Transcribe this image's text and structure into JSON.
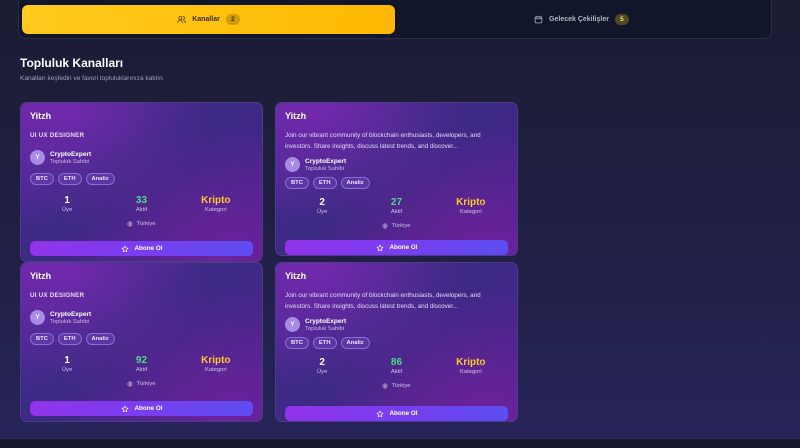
{
  "tabs": [
    {
      "label": "Kanallar",
      "count": "2",
      "icon": "users-icon",
      "active": true
    },
    {
      "label": "Gelecek Çekilişler",
      "count": "5",
      "icon": "calendar-icon",
      "active": false
    }
  ],
  "section": {
    "title": "Topluluk Kanalları",
    "subtitle": "Kanalları keşfedin ve favori topluluklarınıza katılın"
  },
  "cards": [
    {
      "title": "Yitzh",
      "description": "UI UX DESIGNER",
      "owner_initial": "Y",
      "owner_name": "CryptoExpert",
      "owner_role": "Topluluk Sahibi",
      "tags": [
        "BTC",
        "ETH",
        "Analiz"
      ],
      "stats": [
        {
          "value": "1",
          "label": "Üye"
        },
        {
          "value": "33",
          "label": "Aktif"
        },
        {
          "value": "Kripto",
          "label": "Kategori"
        }
      ],
      "country": "Türkiye",
      "button_label": "Abone Ol"
    },
    {
      "title": "Yitzh",
      "description": "Join our vibrant community of blockchain enthusiasts, developers, and investors. Share insights, discuss latest trends, and discover...",
      "owner_initial": "Y",
      "owner_name": "CryptoExpert",
      "owner_role": "Topluluk Sahibi",
      "tags": [
        "BTC",
        "ETH",
        "Analiz"
      ],
      "stats": [
        {
          "value": "2",
          "label": "Üye"
        },
        {
          "value": "27",
          "label": "Aktif"
        },
        {
          "value": "Kripto",
          "label": "Kategori"
        }
      ],
      "country": "Türkiye",
      "button_label": "Abone Ol"
    },
    {
      "title": "Yitzh",
      "description": "UI UX DESIGNER",
      "owner_initial": "Y",
      "owner_name": "CryptoExpert",
      "owner_role": "Topluluk Sahibi",
      "tags": [
        "BTC",
        "ETH",
        "Analiz"
      ],
      "stats": [
        {
          "value": "1",
          "label": "Üye"
        },
        {
          "value": "92",
          "label": "Aktif"
        },
        {
          "value": "Kripto",
          "label": "Kategori"
        }
      ],
      "country": "Türkiye",
      "button_label": "Abone Ol"
    },
    {
      "title": "Yitzh",
      "description": "Join our vibrant community of blockchain enthusiasts, developers, and investors. Share insights, discuss latest trends, and discover...",
      "owner_initial": "Y",
      "owner_name": "CryptoExpert",
      "owner_role": "Topluluk Sahibi",
      "tags": [
        "BTC",
        "ETH",
        "Analiz"
      ],
      "stats": [
        {
          "value": "2",
          "label": "Üye"
        },
        {
          "value": "86",
          "label": "Aktif"
        },
        {
          "value": "Kripto",
          "label": "Kategori"
        }
      ],
      "country": "Türkiye",
      "button_label": "Abone Ol"
    }
  ],
  "colors": {
    "tab_active": "#ffbf0f",
    "stat_member": "#ffffff",
    "stat_active": "#4cd98d",
    "stat_category": "#ffc629",
    "button": "#8a36ee"
  }
}
